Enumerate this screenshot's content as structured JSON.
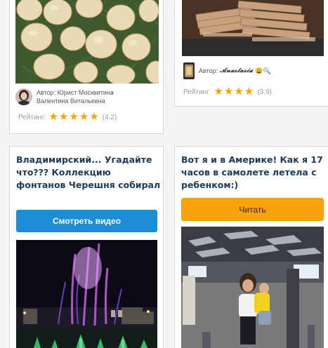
{
  "cards": {
    "top_left": {
      "author_label": "Автор:",
      "author_name_line1": "Юрист Москвитина",
      "author_name_line2": "Валентина Витальевна",
      "rating_label": "Рейтинг:",
      "stars": 5,
      "rating_value": "(4.2)"
    },
    "top_right": {
      "author_label": "Автор:",
      "author_name": "𝓐𝓷𝓪𝓼𝓽𝓪𝓼𝓲𝓪",
      "author_emoji": "😩🔍",
      "rating_label": "Рейтинг:",
      "stars": 4,
      "rating_value": "(3.9)"
    },
    "bottom_left": {
      "title": "Владимирский... Угадайте что??? Коллекцию фонтанов Черешня собирал",
      "button_label": "Смотреть видео"
    },
    "bottom_right": {
      "title": "Вот я и в Америке! Как я 17 часов в самолете летела с ребенком:)",
      "button_label": "Читать"
    }
  },
  "colors": {
    "title": "#1b3b58",
    "star": "#f3a40b",
    "button_blue": "#1a8dd3",
    "button_orange": "#f9a20e"
  }
}
